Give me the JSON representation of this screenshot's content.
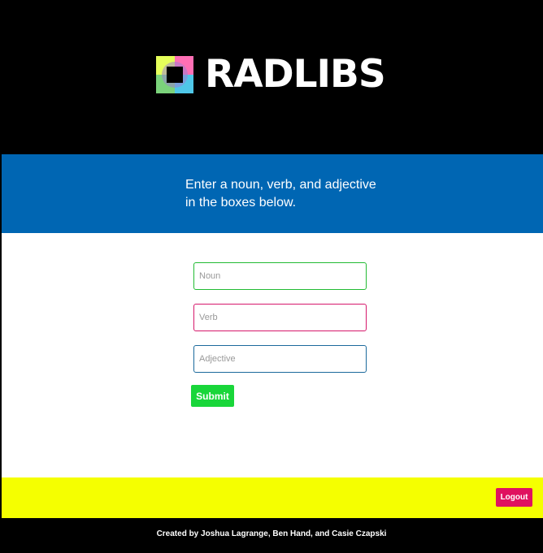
{
  "header": {
    "brand": "RADLIBS",
    "logo_icon": "radlibs-square-logo-icon",
    "logo_colors": [
      "#e6ff5a",
      "#ff6fb5",
      "#4fc7e8",
      "#7bd37b"
    ]
  },
  "banner": {
    "instructions": "Enter a noun, verb, and adjective in the boxes below.",
    "background": "#0066b3"
  },
  "form": {
    "noun": {
      "placeholder": "Noun",
      "value": "",
      "border_color": "#22bb33"
    },
    "verb": {
      "placeholder": "Verb",
      "value": "",
      "border_color": "#d6186b"
    },
    "adjective": {
      "placeholder": "Adjective",
      "value": "",
      "border_color": "#1b6a9c"
    },
    "submit_label": "Submit",
    "submit_color": "#19d63a"
  },
  "action_bar": {
    "background": "#f5ff00",
    "logout_label": "Logout",
    "logout_color": "#e0115f"
  },
  "footer": {
    "credits": "Created by Joshua Lagrange, Ben Hand, and Casie Czapski"
  }
}
